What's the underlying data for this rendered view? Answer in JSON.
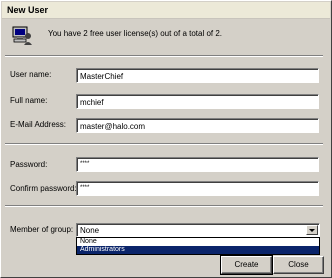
{
  "window": {
    "title": "New User"
  },
  "license": {
    "text": "You have 2 free user license(s) out of a total of 2."
  },
  "form": {
    "username": {
      "label": "User name:",
      "value": "MasterChief"
    },
    "fullname": {
      "label": "Full name:",
      "value": "mchief"
    },
    "email": {
      "label": "E-Mail Address:",
      "value": "master@halo.com"
    },
    "password": {
      "label": "Password:",
      "value": "****"
    },
    "confirm": {
      "label": "Confirm password:",
      "value": "****"
    },
    "group": {
      "label": "Member of group:",
      "value": "None",
      "options": [
        "None",
        "Administrators"
      ],
      "highlighted": "Administrators"
    }
  },
  "buttons": {
    "create": "Create",
    "close": "Close"
  },
  "colors": {
    "highlight": "#0a246a",
    "face": "#d4d0c8"
  },
  "icons": {
    "app": "user-computer-icon",
    "dropdown": "chevron-down-icon"
  }
}
